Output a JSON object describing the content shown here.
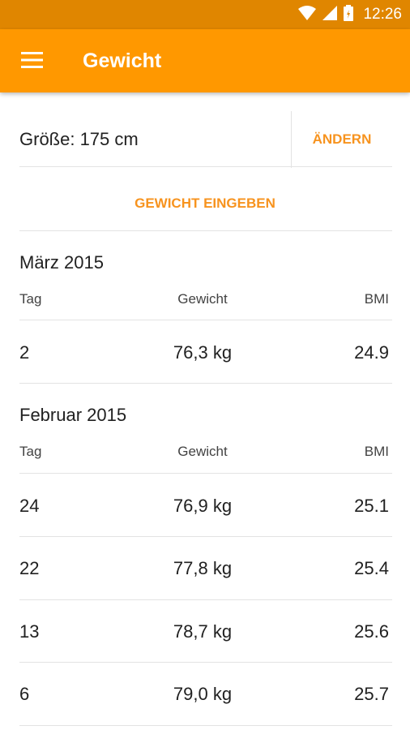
{
  "status_bar": {
    "time": "12:26"
  },
  "app_bar": {
    "title": "Gewicht"
  },
  "height": {
    "label": "Größe: 175 cm",
    "change_label": "ÄNDERN"
  },
  "enter_weight_label": "GEWICHT EINGEBEN",
  "columns": {
    "day": "Tag",
    "weight": "Gewicht",
    "bmi": "BMI"
  },
  "months": [
    {
      "title": "März 2015",
      "rows": [
        {
          "day": "2",
          "weight": "76,3 kg",
          "bmi": "24.9"
        }
      ]
    },
    {
      "title": "Februar 2015",
      "rows": [
        {
          "day": "24",
          "weight": "76,9 kg",
          "bmi": "25.1"
        },
        {
          "day": "22",
          "weight": "77,8 kg",
          "bmi": "25.4"
        },
        {
          "day": "13",
          "weight": "78,7 kg",
          "bmi": "25.6"
        },
        {
          "day": "6",
          "weight": "79,0 kg",
          "bmi": "25.7"
        }
      ]
    }
  ],
  "colors": {
    "status_bar": "#e08600",
    "app_bar": "#ff9800",
    "accent": "#f7931e"
  }
}
